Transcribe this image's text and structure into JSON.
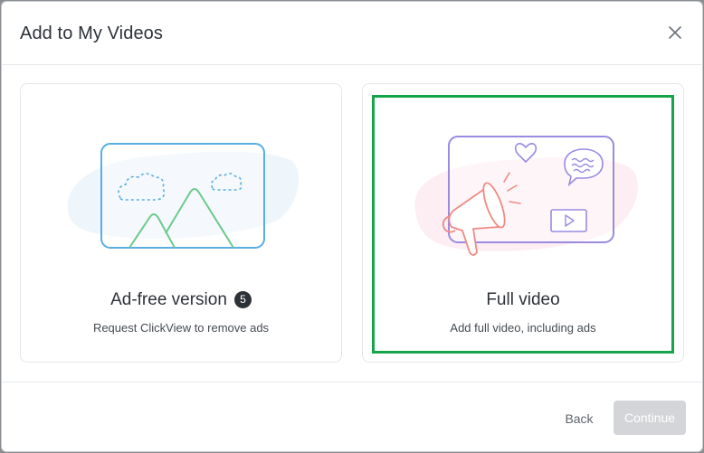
{
  "dialog": {
    "title": "Add to My Videos",
    "close_icon": "close-icon"
  },
  "options": [
    {
      "title": "Ad-free version",
      "badge": "5",
      "subtitle": "Request ClickView to remove ads",
      "icon": "landscape-image-icon",
      "selected": false
    },
    {
      "title": "Full video",
      "subtitle": "Add full video, including ads",
      "icon": "megaphone-video-icon",
      "selected": true
    }
  ],
  "footer": {
    "back_label": "Back",
    "continue_label": "Continue"
  },
  "colors": {
    "selected_border": "#16a34a",
    "continue_disabled_bg": "#d3d5d8",
    "badge_bg": "#2d3239"
  }
}
